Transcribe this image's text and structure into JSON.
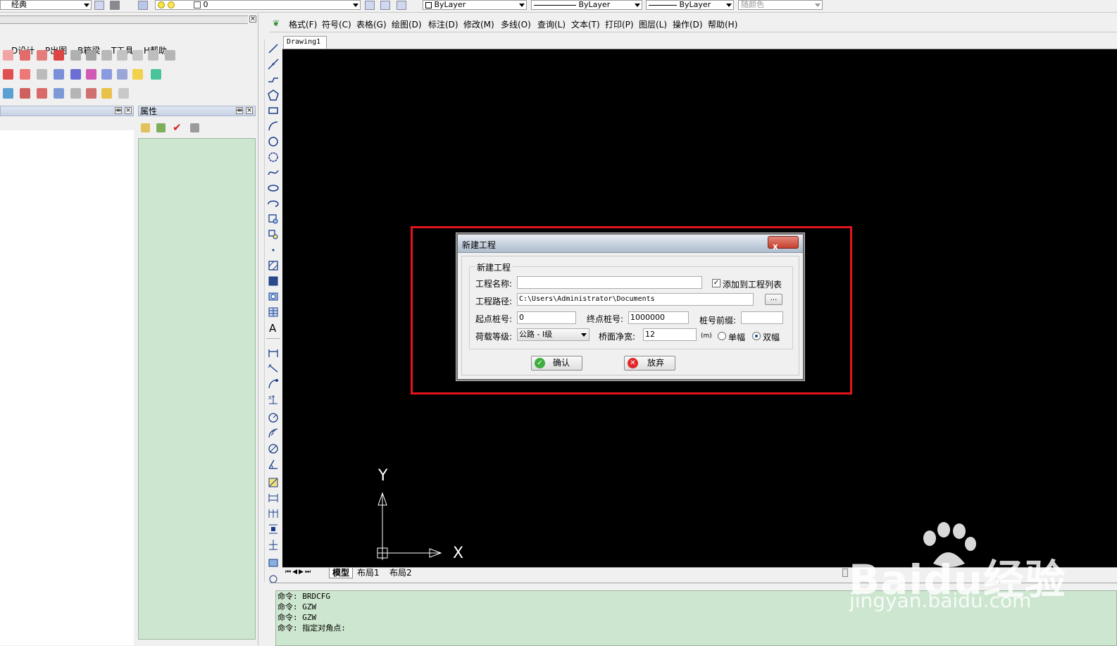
{
  "topbar": {
    "workspace": "经典",
    "layer": "0",
    "color": "ByLayer",
    "linetype": "ByLayer",
    "lineweight": "ByLayer",
    "plotstyle": "随颜色"
  },
  "left_menu": [
    "D设计",
    "P出图",
    "B箱梁",
    "T工具",
    "H帮助"
  ],
  "properties_title": "属性",
  "main_menu": [
    "格式(F)",
    "符号(C)",
    "表格(G)",
    "绘图(D)",
    "标注(D)",
    "修改(M)",
    "多线(O)",
    "查询(L)",
    "文本(T)",
    "打印(P)",
    "图层(L)",
    "操作(D)",
    "帮助(H)"
  ],
  "document_tab": "Drawing1",
  "layout_tabs": [
    "模型",
    "布局1",
    "布局2"
  ],
  "axes": {
    "y": "Y",
    "x": "X"
  },
  "dialog": {
    "title": "新建工程",
    "close": "x",
    "group_title": "新建工程",
    "name_label": "工程名称:",
    "name_value": "",
    "add_to_list_label": "添加到工程列表",
    "add_to_list_checked": true,
    "path_label": "工程路径:",
    "path_value": "C:\\Users\\Administrator\\Documents",
    "browse_label": "...",
    "start_label": "起点桩号:",
    "start_value": "0",
    "end_label": "终点桩号:",
    "end_value": "1000000",
    "prefix_label": "桩号前缀:",
    "prefix_value": "",
    "load_label": "荷载等级:",
    "load_value": "公路 - Ⅰ级",
    "width_label": "桥面净宽:",
    "width_value": "12",
    "width_unit": "(m)",
    "single_label": "单幅",
    "double_label": "双幅",
    "selected_span": "双幅",
    "ok_label": "确认",
    "cancel_label": "放弃"
  },
  "command_lines": [
    "命令: BRDCFG",
    "命令: GZW",
    "命令: GZW",
    "命令: 指定对角点:"
  ],
  "watermark": {
    "brand": "Baidu经验",
    "url": "jingyan.baidu.com"
  },
  "colors": {
    "canvas": "#000000",
    "panel_green": "#cde6cf",
    "highlight": "#e5141c"
  }
}
